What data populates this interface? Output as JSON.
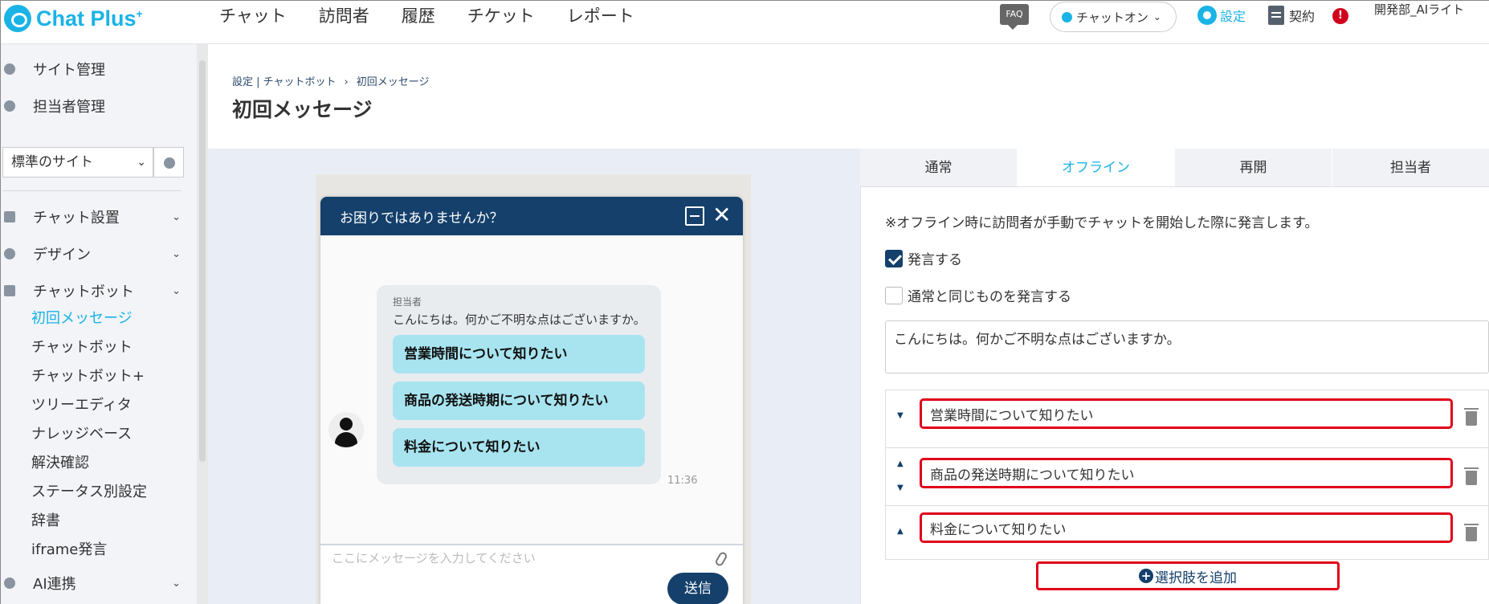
{
  "header": {
    "logo_text": "Chat Plus",
    "logo_sup": "+",
    "nav": [
      "チャット",
      "訪問者",
      "履歴",
      "チケット",
      "レポート"
    ],
    "faq": "FAQ",
    "status": "チャットオン",
    "settings": "設定",
    "contract": "契約",
    "alert": "!",
    "user": "開発部_AIライト"
  },
  "sidebar": {
    "site_admin": "サイト管理",
    "staff_admin": "担当者管理",
    "site_select": "標準のサイト",
    "sections": {
      "chat_setup": "チャット設置",
      "design": "デザイン",
      "chatbot": "チャットボット",
      "ai": "AI連携"
    },
    "chatbot_items": [
      "初回メッセージ",
      "チャットボット",
      "チャットボット+",
      "ツリーエディタ",
      "ナレッジベース",
      "解決確認",
      "ステータス別設定",
      "辞書",
      "iframe発言"
    ]
  },
  "page": {
    "breadcrumb": [
      "設定 | チャットボット",
      "›",
      "初回メッセージ"
    ],
    "title": "初回メッセージ"
  },
  "widget": {
    "title": "お困りではありませんか？",
    "sender": "担当者",
    "greeting": "こんにちは。何かご不明な点はございますか。",
    "options": [
      "営業時間について知りたい",
      "商品の発送時期について知りたい",
      "料金について知りたい"
    ],
    "time": "11:36",
    "input_placeholder": "ここにメッセージを入力してください",
    "send": "送信"
  },
  "settings": {
    "tabs": [
      "通常",
      "オフライン",
      "再開",
      "担当者"
    ],
    "active_tab": "オフライン",
    "note": "※オフライン時に訪問者が手動でチャットを開始した際に発言します。",
    "speak_label": "発言する",
    "speak_checked": true,
    "same_label": "通常と同じものを発言する",
    "same_checked": false,
    "message": "こんにちは。何かご不明な点はございますか。",
    "options": [
      "営業時間について知りたい",
      "商品の発送時期について知りたい",
      "料金について知りたい"
    ],
    "add_option": "選択肢を追加"
  },
  "colors": {
    "brand": "#1ab3e6",
    "navy": "#14406b",
    "highlight": "#e0001a",
    "option_bg": "#a8e4f0"
  }
}
